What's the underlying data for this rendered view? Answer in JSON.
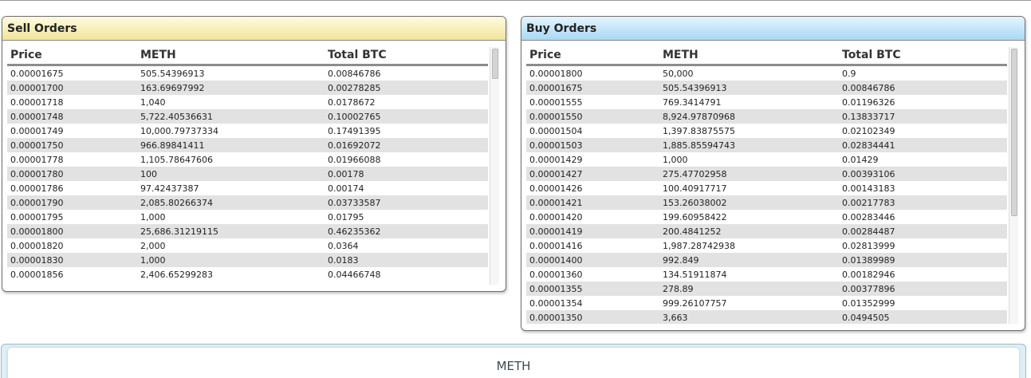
{
  "sell_orders": {
    "title": "Sell Orders",
    "columns": [
      "Price",
      "METH",
      "Total BTC"
    ],
    "rows": [
      [
        "0.00001675",
        "505.54396913",
        "0.00846786"
      ],
      [
        "0.00001700",
        "163.69697992",
        "0.00278285"
      ],
      [
        "0.00001718",
        "1,040",
        "0.0178672"
      ],
      [
        "0.00001748",
        "5,722.40536631",
        "0.10002765"
      ],
      [
        "0.00001749",
        "10,000.79737334",
        "0.17491395"
      ],
      [
        "0.00001750",
        "966.89841411",
        "0.01692072"
      ],
      [
        "0.00001778",
        "1,105.78647606",
        "0.01966088"
      ],
      [
        "0.00001780",
        "100",
        "0.00178"
      ],
      [
        "0.00001786",
        "97.42437387",
        "0.00174"
      ],
      [
        "0.00001790",
        "2,085.80266374",
        "0.03733587"
      ],
      [
        "0.00001795",
        "1,000",
        "0.01795"
      ],
      [
        "0.00001800",
        "25,686.31219115",
        "0.46235362"
      ],
      [
        "0.00001820",
        "2,000",
        "0.0364"
      ],
      [
        "0.00001830",
        "1,000",
        "0.0183"
      ],
      [
        "0.00001856",
        "2,406.65299283",
        "0.04466748"
      ]
    ]
  },
  "buy_orders": {
    "title": "Buy Orders",
    "columns": [
      "Price",
      "METH",
      "Total BTC"
    ],
    "rows": [
      [
        "0.00001800",
        "50,000",
        "0.9"
      ],
      [
        "0.00001675",
        "505.54396913",
        "0.00846786"
      ],
      [
        "0.00001555",
        "769.3414791",
        "0.01196326"
      ],
      [
        "0.00001550",
        "8,924.97870968",
        "0.13833717"
      ],
      [
        "0.00001504",
        "1,397.83875575",
        "0.02102349"
      ],
      [
        "0.00001503",
        "1,885.85594743",
        "0.02834441"
      ],
      [
        "0.00001429",
        "1,000",
        "0.01429"
      ],
      [
        "0.00001427",
        "275.47702958",
        "0.00393106"
      ],
      [
        "0.00001426",
        "100.40917717",
        "0.00143183"
      ],
      [
        "0.00001421",
        "153.26038002",
        "0.00217783"
      ],
      [
        "0.00001420",
        "199.60958422",
        "0.00283446"
      ],
      [
        "0.00001419",
        "200.4841252",
        "0.00284487"
      ],
      [
        "0.00001416",
        "1,987.28742938",
        "0.02813999"
      ],
      [
        "0.00001400",
        "992.849",
        "0.01389989"
      ],
      [
        "0.00001360",
        "134.51911874",
        "0.00182946"
      ],
      [
        "0.00001355",
        "278.89",
        "0.00377896"
      ],
      [
        "0.00001354",
        "999.26107757",
        "0.01352999"
      ],
      [
        "0.00001350",
        "3,663",
        "0.0494505"
      ]
    ]
  },
  "market_panel": {
    "label": "METH"
  }
}
